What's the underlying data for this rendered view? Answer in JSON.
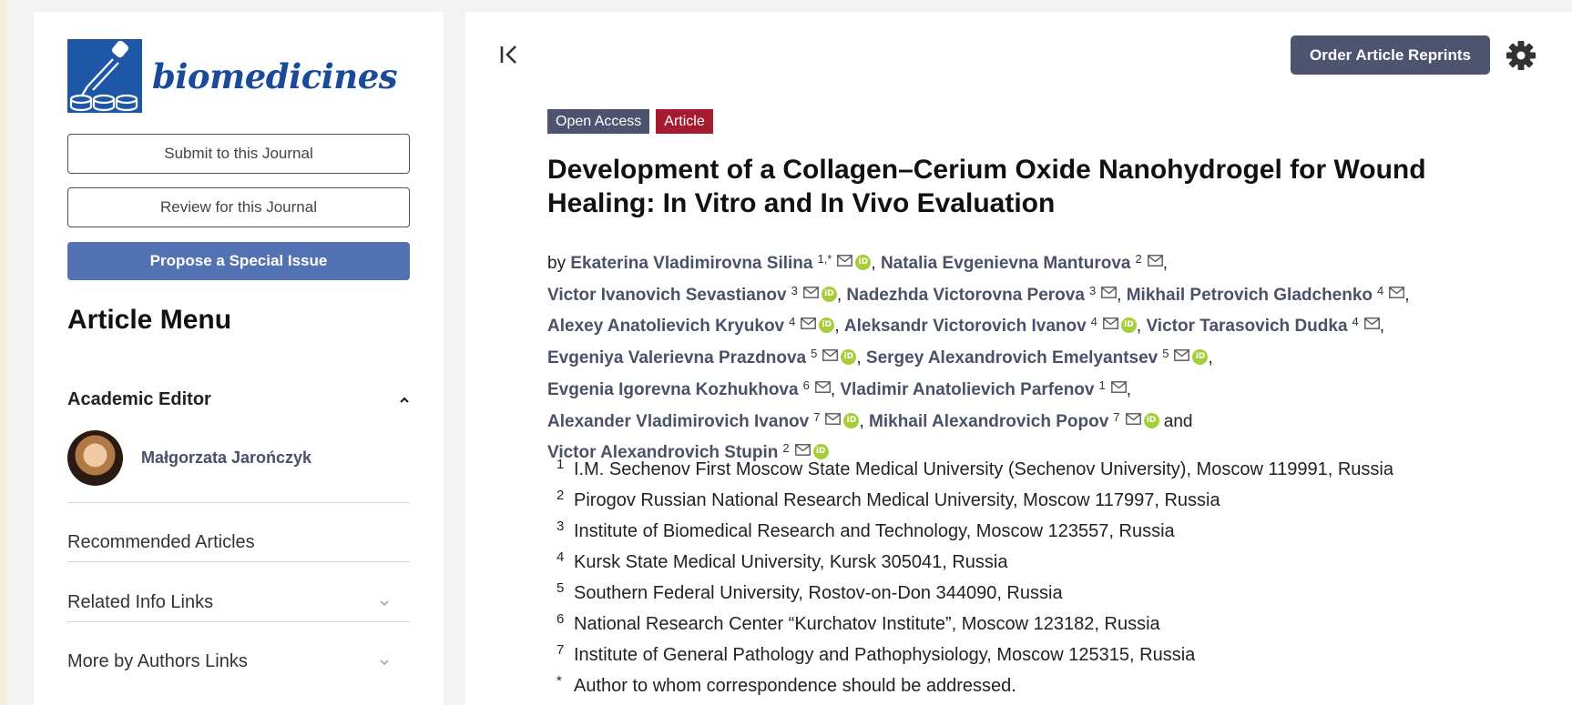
{
  "journal": {
    "name": "biomedicines"
  },
  "sidebar": {
    "submit_label": "Submit to this Journal",
    "review_label": "Review for this Journal",
    "propose_label": "Propose a Special Issue",
    "menu_title": "Article Menu",
    "academic_editor_label": "Academic Editor",
    "editor_name": "Małgorzata Jarończyk",
    "links": [
      {
        "label": "Recommended Articles"
      },
      {
        "label": "Related Info Links"
      },
      {
        "label": "More by Authors Links"
      }
    ]
  },
  "header": {
    "reprints_label": "Order Article Reprints"
  },
  "article": {
    "tags": {
      "open_access": "Open Access",
      "type": "Article"
    },
    "title": "Development of a Collagen–Cerium Oxide Nanohydrogel for Wound Healing: In Vitro and In Vivo Evaluation",
    "by_label": "by",
    "and_label": "and",
    "authors": [
      {
        "name": "Ekaterina Vladimirovna Silina",
        "aff": "1,*",
        "orcid": true
      },
      {
        "name": "Natalia Evgenievna Manturova",
        "aff": "2",
        "orcid": false
      },
      {
        "name": "Victor Ivanovich Sevastianov",
        "aff": "3",
        "orcid": true
      },
      {
        "name": "Nadezhda Victorovna Perova",
        "aff": "3",
        "orcid": false
      },
      {
        "name": "Mikhail Petrovich Gladchenko",
        "aff": "4",
        "orcid": false
      },
      {
        "name": "Alexey Anatolievich Kryukov",
        "aff": "4",
        "orcid": true
      },
      {
        "name": "Aleksandr Victorovich Ivanov",
        "aff": "4",
        "orcid": true
      },
      {
        "name": "Victor Tarasovich Dudka",
        "aff": "4",
        "orcid": false
      },
      {
        "name": "Evgeniya Valerievna Prazdnova",
        "aff": "5",
        "orcid": true
      },
      {
        "name": "Sergey Alexandrovich Emelyantsev",
        "aff": "5",
        "orcid": true
      },
      {
        "name": "Evgenia Igorevna Kozhukhova",
        "aff": "6",
        "orcid": false
      },
      {
        "name": "Vladimir Anatolievich Parfenov",
        "aff": "1",
        "orcid": false
      },
      {
        "name": "Alexander Vladimirovich Ivanov",
        "aff": "7",
        "orcid": true
      },
      {
        "name": "Mikhail Alexandrovich Popov",
        "aff": "7",
        "orcid": true
      },
      {
        "name": "Victor Alexandrovich Stupin",
        "aff": "2",
        "orcid": true
      }
    ],
    "affiliations": [
      {
        "num": "1",
        "text": "I.M. Sechenov First Moscow State Medical University (Sechenov University), Moscow 119991, Russia"
      },
      {
        "num": "2",
        "text": "Pirogov Russian National Research Medical University, Moscow 117997, Russia"
      },
      {
        "num": "3",
        "text": "Institute of Biomedical Research and Technology, Moscow 123557, Russia"
      },
      {
        "num": "4",
        "text": "Kursk State Medical University, Kursk 305041, Russia"
      },
      {
        "num": "5",
        "text": "Southern Federal University, Rostov-on-Don 344090, Russia"
      },
      {
        "num": "6",
        "text": "National Research Center “Kurchatov Institute”, Moscow 123182, Russia"
      },
      {
        "num": "7",
        "text": "Institute of General Pathology and Pathophysiology, Moscow 125315, Russia"
      },
      {
        "num": "*",
        "text": "Author to whom correspondence should be addressed."
      }
    ]
  }
}
